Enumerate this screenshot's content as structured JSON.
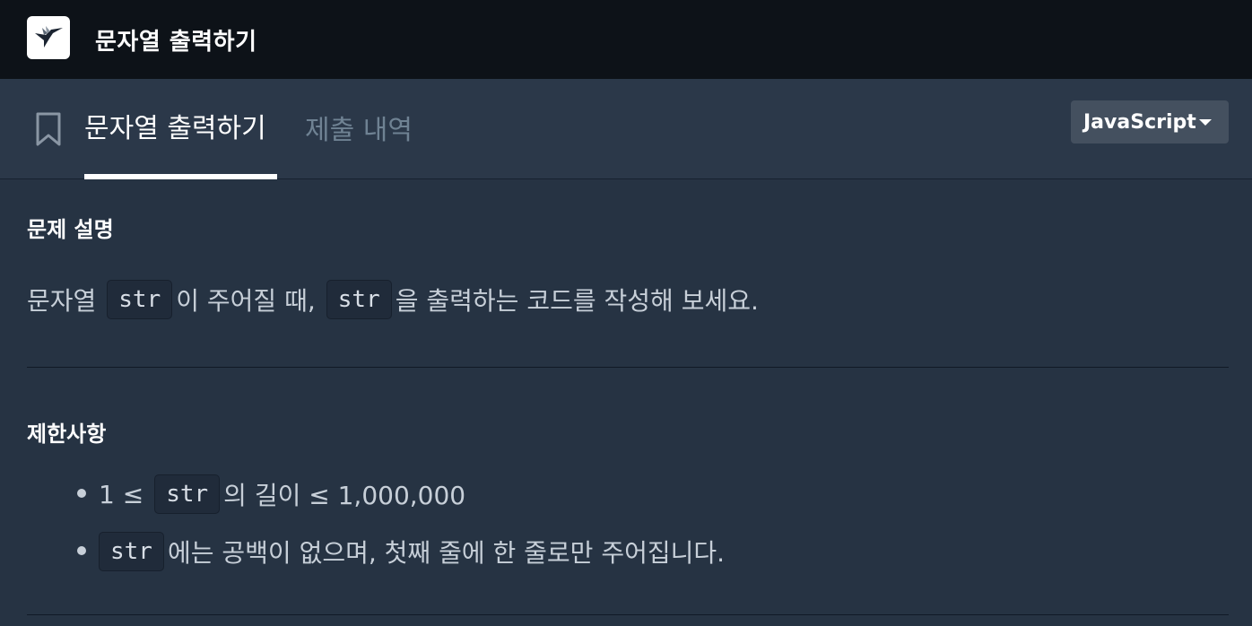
{
  "header": {
    "title": "문자열 출력하기",
    "logo_icon": "hummingbird-logo-icon"
  },
  "tabs": {
    "active_label": "문자열 출력하기",
    "inactive_label": "제출 내역",
    "bookmark_icon": "bookmark-icon"
  },
  "language_select": {
    "value": "JavaScript",
    "caret_icon": "caret-down-icon"
  },
  "description": {
    "title": "문제 설명",
    "line": {
      "p1": "문자열",
      "code1": "str",
      "p2": "이 주어질 때,",
      "code2": "str",
      "p3": "을 출력하는 코드를 작성해 보세요."
    }
  },
  "constraints": {
    "title": "제한사항",
    "items": [
      {
        "p1": "1 ≤",
        "code": "str",
        "p2": "의 길이 ≤ 1,000,000"
      },
      {
        "code": "str",
        "p2": "에는 공백이 없으며, 첫째 줄에 한 줄로만 주어집니다."
      }
    ]
  }
}
